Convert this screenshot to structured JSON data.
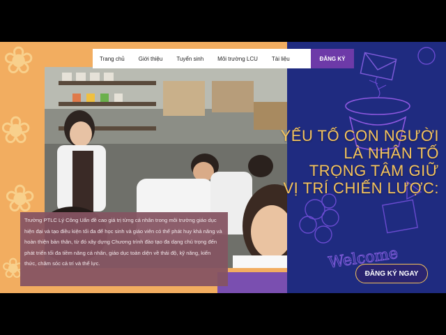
{
  "nav": {
    "items": [
      {
        "label": "Trang chủ"
      },
      {
        "label": "Giới thiệu"
      },
      {
        "label": "Tuyển sinh"
      },
      {
        "label": "Môi trường LCU"
      },
      {
        "label": "Tài liệu"
      }
    ],
    "cta_label": "ĐĂNG KÝ"
  },
  "hero": {
    "headline": [
      "YẾU TỐ CON NGƯỜI",
      "LÀ NHÂN TỐ",
      "TRỌNG TÂM GIỮ",
      "VỊ TRÍ CHIẾN LƯỢC:"
    ],
    "body": "Trường PTLC Lý Công Uẩn đề cao giá trị từng cá nhân trong môi trường giáo dục hiện đại và tạo điều kiện tối đa để học sinh và giáo viên có thể phát huy khả năng và hoàn thiện bản thân, từ đó xây dựng Chương trình đào tạo đa dạng chú trọng đến phát triển tối đa tiềm năng cá nhân, giáo dục toàn diện về thái độ, kỹ năng, kiến thức, chăm sóc cả trí và thể lực.",
    "cta_label": "ĐĂNG KÝ NGAY",
    "doodle_text": "Welcome"
  },
  "colors": {
    "accent": "#f6c45c",
    "left_bg": "#f2ad60",
    "right_bg": "#1f2b80",
    "nav_cta": "#6d3aa8"
  }
}
